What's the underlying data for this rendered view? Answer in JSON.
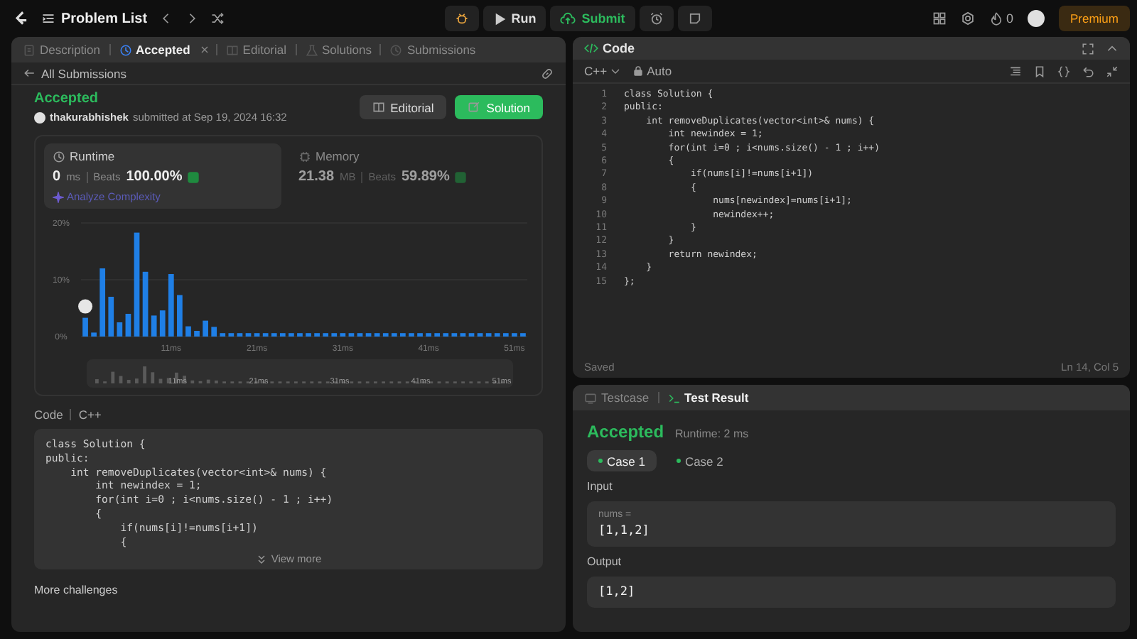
{
  "top_bar": {
    "problem_list": "Problem List",
    "run": "Run",
    "submit": "Submit",
    "streak": "0",
    "premium": "Premium"
  },
  "left_panel": {
    "tabs": [
      {
        "label": "Description",
        "selected": false,
        "closable": false
      },
      {
        "label": "Accepted",
        "selected": true,
        "closable": true
      },
      {
        "label": "Editorial",
        "selected": false,
        "closable": false
      },
      {
        "label": "Solutions",
        "selected": false,
        "closable": false
      },
      {
        "label": "Submissions",
        "selected": false,
        "closable": false
      }
    ],
    "back_link": "All Submissions",
    "status": "Accepted",
    "user": "thakurabhishek",
    "submitted": "submitted at Sep 19, 2024 16:32",
    "buttons": [
      {
        "label": "Editorial",
        "kind": "secondary"
      },
      {
        "label": "Solution",
        "kind": "primary"
      }
    ],
    "metrics": [
      {
        "label": "Runtime",
        "value": "0",
        "unit": "ms",
        "beats_label": "Beats",
        "beats": "100.00%",
        "selected": true,
        "link": "Analyze Complexity"
      },
      {
        "label": "Memory",
        "value": "21.38",
        "unit": "MB",
        "beats_label": "Beats",
        "beats": "59.89%",
        "selected": false
      }
    ],
    "chart_data": {
      "type": "bar",
      "x": [
        1,
        2,
        3,
        4,
        5,
        6,
        7,
        8,
        9,
        10,
        11,
        12,
        13,
        14,
        15,
        16,
        17,
        18,
        19,
        20,
        21,
        22,
        23,
        24,
        25,
        26,
        27,
        28,
        29,
        30,
        31,
        32,
        33,
        34,
        35,
        36,
        37,
        38,
        39,
        40,
        41,
        42,
        43,
        44,
        45,
        46,
        47,
        48,
        49,
        50,
        51,
        52
      ],
      "series": [
        {
          "color": "#1f7fe6",
          "values": [
            3.3,
            0.7,
            12,
            7,
            2.5,
            4,
            18.3,
            11.4,
            3.7,
            4.6,
            11,
            7.3,
            1.8,
            1,
            2.8,
            1.7,
            0.6,
            0.6,
            0.6,
            0.6,
            0.6,
            0.6,
            0.6,
            0.6,
            0.6,
            0.6,
            0.6,
            0.6,
            0.6,
            0.6,
            0.6,
            0.6,
            0.6,
            0.6,
            0.6,
            0.6,
            0.6,
            0.6,
            0.6,
            0.6,
            0.6,
            0.6,
            0.6,
            0.6,
            0.6,
            0.6,
            0.6,
            0.6,
            0.6,
            0.6,
            0.6,
            0.6
          ]
        }
      ],
      "xlim": [
        0.5,
        52.5
      ],
      "ylim": [
        0,
        20
      ],
      "xticks": [
        {
          "value": 11,
          "label": "11ms"
        },
        {
          "value": 21,
          "label": "21ms"
        },
        {
          "value": 31,
          "label": "31ms"
        },
        {
          "value": 41,
          "label": "41ms"
        },
        {
          "value": 51,
          "label": "51ms"
        }
      ],
      "yticks": [
        {
          "value": 0,
          "label": "0%"
        },
        {
          "value": 10,
          "label": "10%"
        },
        {
          "value": 20,
          "label": "20%"
        }
      ]
    },
    "overview_labels": [
      "11ms",
      "21ms",
      "31ms",
      "41ms",
      "51ms"
    ],
    "code_label": "Code",
    "code_language": "C++",
    "code_lines": [
      "class Solution {",
      "public:",
      "    int removeDuplicates(vector<int>& nums) {",
      "        int newindex = 1;",
      "        for(int i=0 ; i<nums.size() - 1 ; i++)",
      "        {",
      "            if(nums[i]!=nums[i+1])",
      "            {"
    ],
    "view_more": "View more",
    "more_challenges": "More challenges"
  },
  "editor": {
    "title": "Code",
    "language": "C++",
    "mode": "Auto",
    "lines": [
      {
        "number": "1",
        "text": "class Solution {"
      },
      {
        "number": "2",
        "text": "public:"
      },
      {
        "number": "3",
        "text": "    int removeDuplicates(vector<int>& nums) {"
      },
      {
        "number": "4",
        "text": "        int newindex = 1;"
      },
      {
        "number": "5",
        "text": "        for(int i=0 ; i<nums.size() - 1 ; i++)"
      },
      {
        "number": "6",
        "text": "        {"
      },
      {
        "number": "7",
        "text": "            if(nums[i]!=nums[i+1])"
      },
      {
        "number": "8",
        "text": "            {"
      },
      {
        "number": "9",
        "text": "                nums[newindex]=nums[i+1];"
      },
      {
        "number": "10",
        "text": "                newindex++;"
      },
      {
        "number": "11",
        "text": "            }"
      },
      {
        "number": "12",
        "text": "        }"
      },
      {
        "number": "13",
        "text": "        return newindex;"
      },
      {
        "number": "14",
        "text": "    }"
      },
      {
        "number": "15",
        "text": "};"
      }
    ],
    "status": "Saved",
    "cursor": "Ln 14, Col 5"
  },
  "results": {
    "tabs": [
      {
        "label": "Testcase",
        "selected": false
      },
      {
        "label": "Test Result",
        "selected": true
      }
    ],
    "verdict": "Accepted",
    "runtime": "Runtime: 2 ms",
    "cases": [
      {
        "label": "Case 1",
        "selected": true
      },
      {
        "label": "Case 2",
        "selected": false
      }
    ],
    "input_label": "Input",
    "inputs": [
      {
        "name": "nums =",
        "value": "[1,1,2]"
      }
    ],
    "output_label": "Output",
    "output": "[1,2]"
  }
}
